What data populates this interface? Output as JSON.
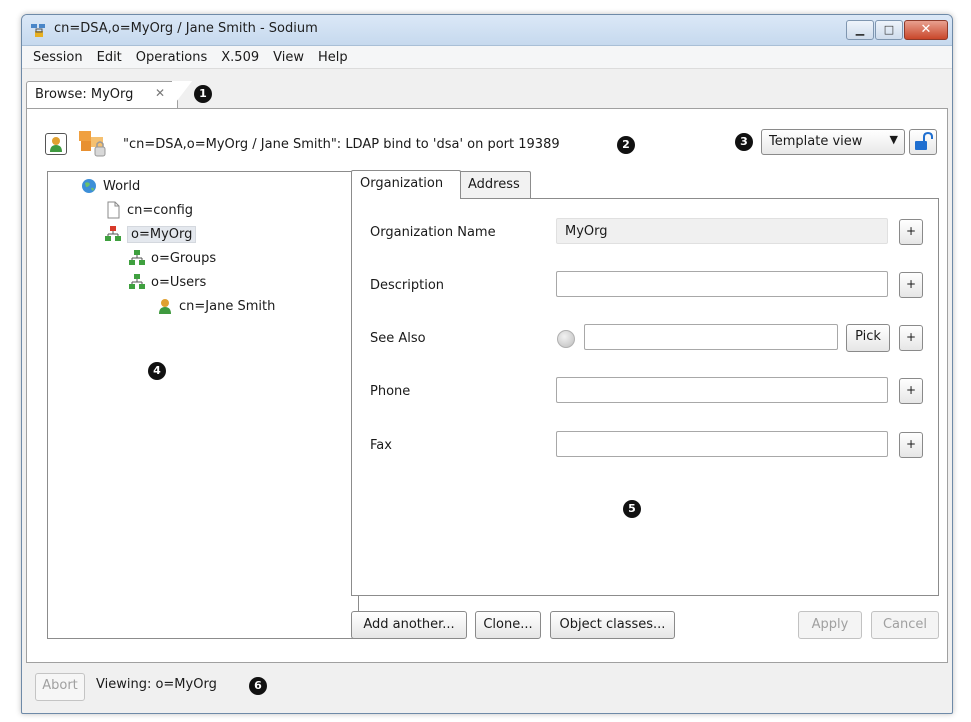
{
  "window": {
    "title": "cn=DSA,o=MyOrg / Jane Smith - Sodium",
    "controls": {
      "minimize": "▁",
      "maximize": "□",
      "close": "✕"
    }
  },
  "menu": [
    "Session",
    "Edit",
    "Operations",
    "X.509",
    "View",
    "Help"
  ],
  "main_tab": {
    "label": "Browse: MyOrg",
    "close_glyph": "✕"
  },
  "callouts": [
    "1",
    "2",
    "3",
    "4",
    "5",
    "6"
  ],
  "header": {
    "bind_text": "\"cn=DSA,o=MyOrg / Jane Smith\": LDAP bind to 'dsa' on port 19389",
    "view_select": "Template view",
    "dropdown_glyph": "▼"
  },
  "tree": [
    {
      "label": "World",
      "icon": "globe-icon"
    },
    {
      "label": "cn=config",
      "icon": "document-icon"
    },
    {
      "label": "o=MyOrg",
      "icon": "org-icon"
    },
    {
      "label": "o=Groups",
      "icon": "org-icon"
    },
    {
      "label": "o=Users",
      "icon": "org-icon"
    },
    {
      "label": "cn=Jane Smith",
      "icon": "person-icon"
    }
  ],
  "form": {
    "tabs": [
      "Organization",
      "Address"
    ],
    "fields": [
      {
        "label": "Organization Name",
        "value": "MyOrg"
      },
      {
        "label": "Description",
        "value": ""
      },
      {
        "label": "See Also",
        "value": "",
        "pick": "Pick"
      },
      {
        "label": "Phone",
        "value": ""
      },
      {
        "label": "Fax",
        "value": ""
      }
    ],
    "plus": "+"
  },
  "buttons": {
    "add_another": "Add another...",
    "clone": "Clone...",
    "object_classes": "Object classes...",
    "apply": "Apply",
    "cancel": "Cancel"
  },
  "status": {
    "abort": "Abort",
    "text": "Viewing: o=MyOrg"
  },
  "colors": {
    "titlebar": "#c6d9ee",
    "close_button": "#c9472a",
    "selection": "#e4e8ee"
  }
}
